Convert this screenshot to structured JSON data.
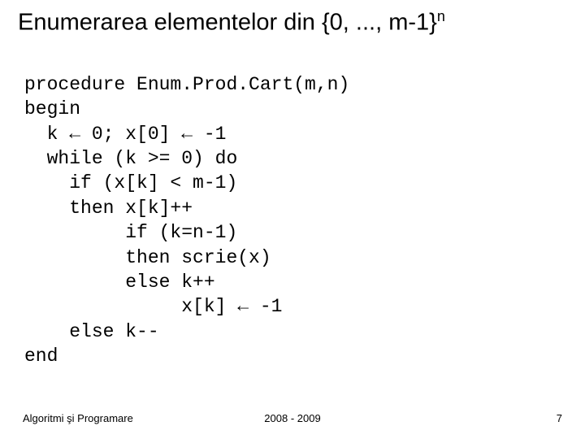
{
  "title": {
    "text_prefix": "Enumerarea elementelor din {0, ..., m-1}",
    "superscript": "n"
  },
  "code": {
    "l1": "procedure Enum.Prod.Cart(m,n)",
    "l2": "begin",
    "l3": "  k ← 0; x[0] ← -1",
    "l4": "  while (k >= 0) do",
    "l5": "    if (x[k] < m-1)",
    "l6": "    then x[k]++",
    "l7": "         if (k=n-1)",
    "l8": "         then scrie(x)",
    "l9": "         else k++",
    "l10": "              x[k] ← -1",
    "l11": "    else k--",
    "l12": "end"
  },
  "footer": {
    "left": "Algoritmi şi Programare",
    "center": "2008 - 2009",
    "right": "7"
  }
}
